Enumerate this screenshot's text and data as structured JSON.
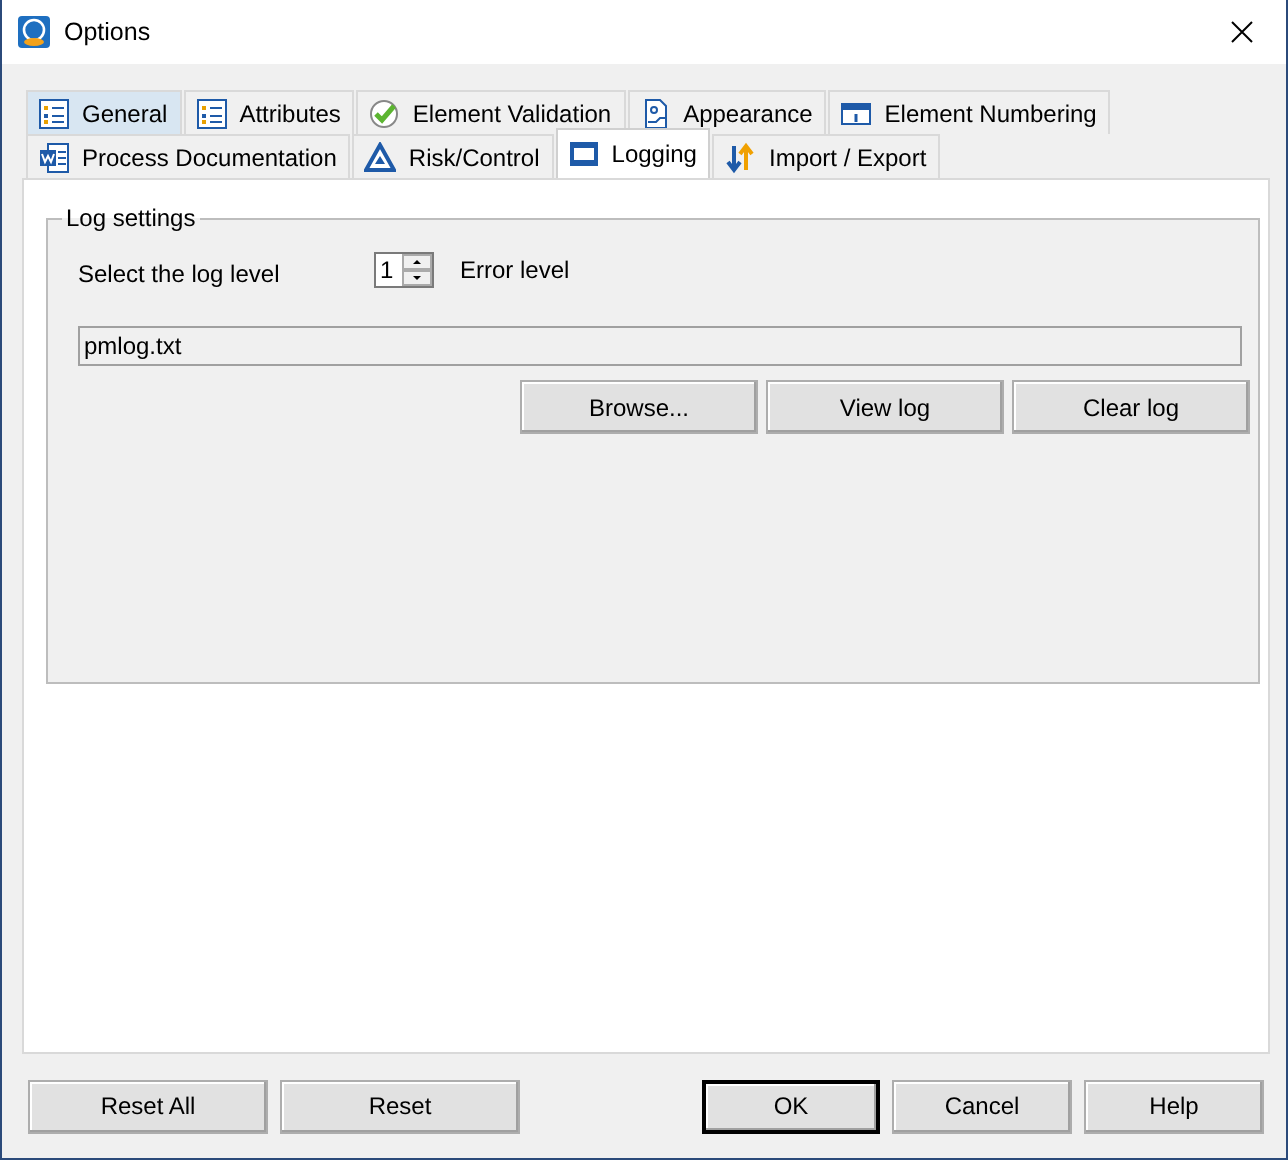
{
  "window": {
    "title": "Options"
  },
  "tab_rows": [
    [
      {
        "label": "General",
        "kind": "list",
        "selected": false,
        "highlighted": true
      },
      {
        "label": "Attributes",
        "kind": "list",
        "selected": false,
        "highlighted": false
      },
      {
        "label": "Element Validation",
        "kind": "check",
        "selected": false,
        "highlighted": false
      },
      {
        "label": "Appearance",
        "kind": "form",
        "selected": false,
        "highlighted": false
      },
      {
        "label": "Element Numbering",
        "kind": "numbering",
        "selected": false,
        "highlighted": false
      }
    ],
    [
      {
        "label": "Process Documentation",
        "kind": "document",
        "selected": false,
        "highlighted": false
      },
      {
        "label": "Risk/Control",
        "kind": "triangle",
        "selected": false,
        "highlighted": false
      },
      {
        "label": "Logging",
        "kind": "window",
        "selected": true,
        "highlighted": false
      },
      {
        "label": "Import / Export",
        "kind": "arrows",
        "selected": false,
        "highlighted": false
      }
    ]
  ],
  "log_settings": {
    "title": "Log settings",
    "level_label": "Select the log level",
    "level_value": "1",
    "level_name": "Error level",
    "file": "pmlog.txt",
    "buttons": [
      "Browse...",
      "View log",
      "Clear log"
    ]
  },
  "footer": {
    "left_buttons": [
      {
        "label": "Reset All",
        "default": false
      },
      {
        "label": "Reset",
        "default": false
      }
    ],
    "right_buttons": [
      {
        "label": "OK",
        "default": true
      },
      {
        "label": "Cancel",
        "default": false
      },
      {
        "label": "Help",
        "default": false
      }
    ]
  }
}
